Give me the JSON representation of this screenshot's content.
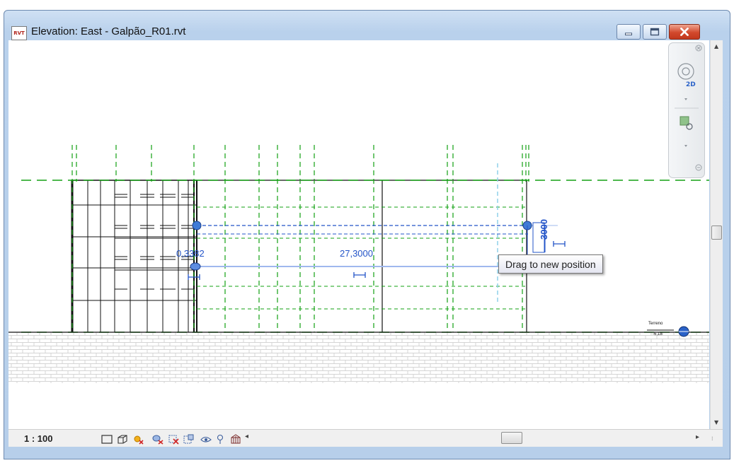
{
  "window": {
    "app_icon_text": "RVT",
    "title": "Elevation: East - Galpão_R01.rvt"
  },
  "view": {
    "dimension_left": "0,3382",
    "dimension_middle": "27,3000",
    "dimension_vertical": "3000",
    "level_marker_name": "Terreno",
    "level_marker_value": "-6,18",
    "tooltip": "Drag to new position"
  },
  "navigation_bar": {
    "wheel_label": "2D"
  },
  "status_bar": {
    "scale": "1 : 100"
  },
  "colors": {
    "grid_green": "#13a113",
    "selection_blue": "#2354c8",
    "ref_plane_light_blue": "#8fd0ea",
    "close_button_red": "#c2381d"
  }
}
